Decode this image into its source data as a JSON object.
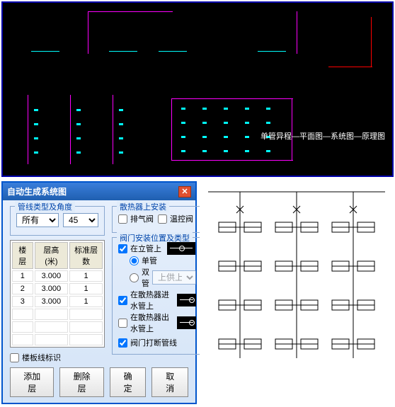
{
  "cad": {
    "annotation": "单管异程—平面图—系统图—原理图"
  },
  "dialog": {
    "title": "自动生成系统图",
    "group_pipe": {
      "legend": "管线类型及角度",
      "type_options": [
        "所有"
      ],
      "type_selected": "所有",
      "angle_options": [
        "45"
      ],
      "angle_selected": "45"
    },
    "group_radiator": {
      "legend": "散热器上安装",
      "vent_valve": "排气阀",
      "thermo_valve": "温控阀"
    },
    "table": {
      "headers": [
        "楼层",
        "层高(米)",
        "标准层数"
      ],
      "rows": [
        [
          "1",
          "3.000",
          "1"
        ],
        [
          "2",
          "3.000",
          "1"
        ],
        [
          "3",
          "3.000",
          "1"
        ]
      ]
    },
    "group_valve": {
      "legend": "阀门安装位置及类型",
      "on_riser": "在立管上",
      "single_pipe": "单管",
      "double_pipe": "双管",
      "supply_return": "上供上回",
      "on_inlet": "在散热器进水管上",
      "on_outlet": "在散热器出水管上",
      "break_riser": "阀门打断管线"
    },
    "floor_marker": "楼板线标识",
    "buttons": {
      "add_floor": "添加层",
      "delete_floor": "删除层",
      "ok": "确定",
      "cancel": "取消"
    }
  }
}
